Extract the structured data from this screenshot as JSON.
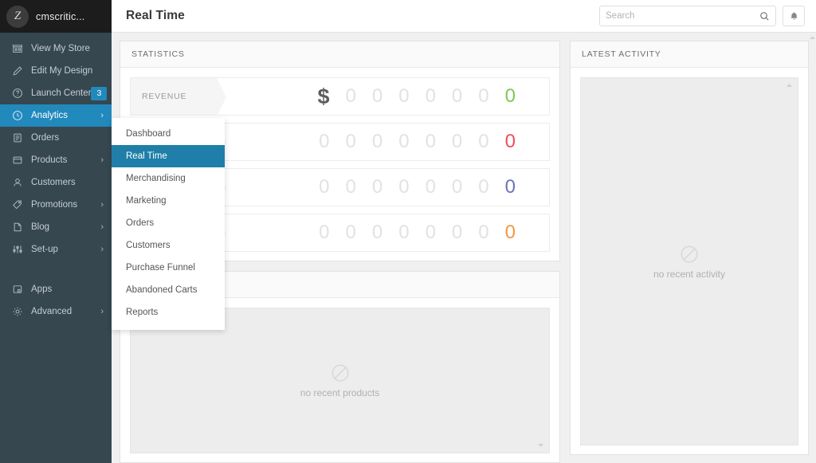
{
  "brand": {
    "logo_letter": "Z",
    "logo_icon": "zoey-logo-icon",
    "name": "cmscritic..."
  },
  "sidebar": {
    "items": [
      {
        "label": "View My Store",
        "icon": "store-icon",
        "chevron": false,
        "badge": null,
        "active": false
      },
      {
        "label": "Edit My Design",
        "icon": "pencil-icon",
        "chevron": false,
        "badge": null,
        "active": false
      },
      {
        "label": "Launch Center",
        "icon": "help-circle-icon",
        "chevron": false,
        "badge": "3",
        "active": false
      },
      {
        "label": "Analytics",
        "icon": "analytics-icon",
        "chevron": true,
        "badge": null,
        "active": true
      },
      {
        "label": "Orders",
        "icon": "orders-icon",
        "chevron": false,
        "badge": null,
        "active": false
      },
      {
        "label": "Products",
        "icon": "products-icon",
        "chevron": true,
        "badge": null,
        "active": false
      },
      {
        "label": "Customers",
        "icon": "customers-icon",
        "chevron": false,
        "badge": null,
        "active": false
      },
      {
        "label": "Promotions",
        "icon": "tag-icon",
        "chevron": true,
        "badge": null,
        "active": false
      },
      {
        "label": "Blog",
        "icon": "blog-icon",
        "chevron": true,
        "badge": null,
        "active": false
      },
      {
        "label": "Set-up",
        "icon": "sliders-icon",
        "chevron": true,
        "badge": null,
        "active": false
      }
    ],
    "items_bottom": [
      {
        "label": "Apps",
        "icon": "apps-icon",
        "chevron": false,
        "badge": null,
        "active": false
      },
      {
        "label": "Advanced",
        "icon": "gear-icon",
        "chevron": true,
        "badge": null,
        "active": false
      }
    ],
    "chevron_glyph": "›"
  },
  "header": {
    "title": "Real Time",
    "search": {
      "placeholder": "Search",
      "value": "",
      "icon": "search-icon"
    },
    "notifications_icon": "bell-icon"
  },
  "dropdown": {
    "name": "analytics-submenu",
    "items": [
      {
        "label": "Dashboard",
        "active": false
      },
      {
        "label": "Real Time",
        "active": true
      },
      {
        "label": "Merchandising",
        "active": false
      },
      {
        "label": "Marketing",
        "active": false
      },
      {
        "label": "Orders",
        "active": false
      },
      {
        "label": "Customers",
        "active": false
      },
      {
        "label": "Purchase Funnel",
        "active": false
      },
      {
        "label": "Abandoned Carts",
        "active": false
      },
      {
        "label": "Reports",
        "active": false
      }
    ]
  },
  "statistics": {
    "panel_title": "STATISTICS",
    "rows": [
      {
        "label": "REVENUE",
        "symbol": "$",
        "digits": [
          "0",
          "0",
          "0",
          "0",
          "0",
          "0"
        ],
        "last_digit": "0",
        "accent": "#7ec855"
      },
      {
        "label": "",
        "symbol": "",
        "digits": [
          "0",
          "0",
          "0",
          "0",
          "0",
          "0",
          "0"
        ],
        "last_digit": "0",
        "accent": "#ef4e5a"
      },
      {
        "label": "",
        "symbol": "",
        "digits": [
          "0",
          "0",
          "0",
          "0",
          "0",
          "0",
          "0"
        ],
        "last_digit": "0",
        "accent": "#6f72b8"
      },
      {
        "label": "",
        "symbol": "",
        "digits": [
          "0",
          "0",
          "0",
          "0",
          "0",
          "0",
          "0"
        ],
        "last_digit": "0",
        "accent": "#f2993f"
      }
    ]
  },
  "products_panel": {
    "panel_title": "",
    "empty_text": "no recent products",
    "empty_icon": "no-entry-icon"
  },
  "latest_activity": {
    "panel_title": "LATEST ACTIVITY",
    "empty_text": "no recent activity",
    "empty_icon": "no-entry-icon"
  },
  "colors": {
    "sidebar_bg": "#364750",
    "brand_bg": "#1c1c1c",
    "accent_blue": "#2289bd",
    "dropdown_active": "#1f7fa8",
    "content_bg": "#f0f0f0"
  }
}
